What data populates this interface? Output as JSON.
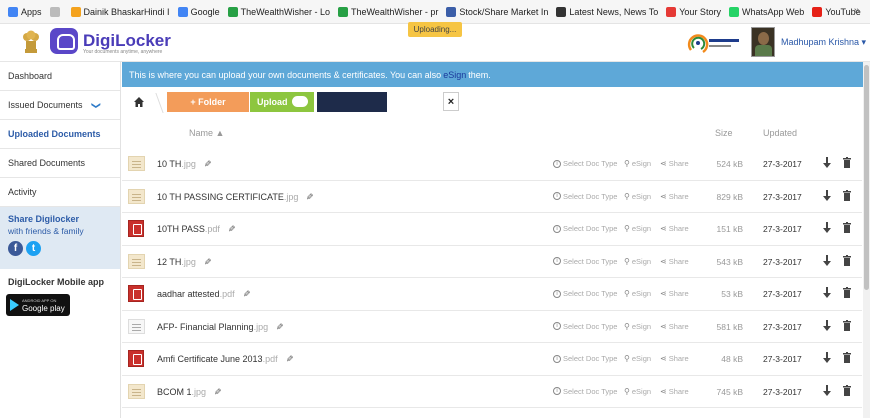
{
  "bookmarks": [
    {
      "label": "Apps",
      "icon": "apps-grid-icon",
      "color": "#4285f4"
    },
    {
      "label": "",
      "icon": "page-icon",
      "color": "#bbbbbb"
    },
    {
      "label": "Dainik BhaskarHindi I",
      "icon": "dainik-bhaskar-icon",
      "color": "#f4a21d"
    },
    {
      "label": "Google",
      "icon": "google-icon",
      "color": "#4285f4"
    },
    {
      "label": "TheWealthWisher - Lo",
      "icon": "wealthwisher-icon",
      "color": "#27a045"
    },
    {
      "label": "TheWealthWisher - pr",
      "icon": "wealthwisher-icon",
      "color": "#27a045"
    },
    {
      "label": "Stock/Share Market In",
      "icon": "stock-market-icon",
      "color": "#3b5ea8"
    },
    {
      "label": "Latest News, News To",
      "icon": "news-icon",
      "color": "#333333"
    },
    {
      "label": "Your Story",
      "icon": "yourstory-icon",
      "color": "#e53935"
    },
    {
      "label": "WhatsApp Web",
      "icon": "whatsapp-icon",
      "color": "#25d366"
    },
    {
      "label": "YouTube",
      "icon": "youtube-icon",
      "color": "#e62117"
    }
  ],
  "bookmarks_more": "»",
  "app": {
    "name": "DigiLocker",
    "tagline": "Your documents anytime, anywhere",
    "brand_color": "#4a3cb8",
    "uploading_label": "Uploading...",
    "user_name": "Madhupam Krishna ▾"
  },
  "sidebar": {
    "items": [
      {
        "label": "Dashboard",
        "active": false
      },
      {
        "label": "Issued Documents",
        "active": false,
        "chevron": "❯"
      },
      {
        "label": "Uploaded Documents",
        "active": true
      },
      {
        "label": "Shared Documents",
        "active": false
      },
      {
        "label": "Activity",
        "active": false
      }
    ],
    "share_title": "Share Digilocker",
    "share_sub": "with friends & family",
    "facebook": "f",
    "twitter": "t",
    "mobile_title": "DigiLocker Mobile app",
    "gplay_small": "ANDROID APP ON",
    "gplay_big": "Google play"
  },
  "banner": {
    "text_before": "This is where you can upload your own documents & certificates. You can also",
    "link": "eSign",
    "text_after": "them."
  },
  "toolbar": {
    "folder_label": "+ Folder",
    "upload_label": "Upload",
    "close_label": "×"
  },
  "table": {
    "col_name": "Name ▲",
    "col_size": "Size",
    "col_updated": "Updated",
    "action_doc_type": "Select Doc Type",
    "action_esign": "eSign",
    "action_share": "Share",
    "rows": [
      {
        "name": "10 TH",
        "ext": ".jpg",
        "type": "img",
        "size": "524 kB",
        "date": "27-3-2017"
      },
      {
        "name": "10 TH PASSING CERTIFICATE",
        "ext": ".jpg",
        "type": "img",
        "size": "829 kB",
        "date": "27-3-2017"
      },
      {
        "name": "10TH PASS",
        "ext": ".pdf",
        "type": "pdf",
        "size": "151 kB",
        "date": "27-3-2017"
      },
      {
        "name": "12 TH",
        "ext": ".jpg",
        "type": "img",
        "size": "543 kB",
        "date": "27-3-2017"
      },
      {
        "name": "aadhar attested",
        "ext": ".pdf",
        "type": "pdf",
        "size": "53 kB",
        "date": "27-3-2017"
      },
      {
        "name": "AFP- Financial Planning",
        "ext": ".jpg",
        "type": "img2",
        "size": "581 kB",
        "date": "27-3-2017"
      },
      {
        "name": "Amfi Certificate June 2013",
        "ext": ".pdf",
        "type": "pdf",
        "size": "48 kB",
        "date": "27-3-2017"
      },
      {
        "name": "BCOM 1",
        "ext": ".jpg",
        "type": "img",
        "size": "745 kB",
        "date": "27-3-2017"
      }
    ]
  }
}
